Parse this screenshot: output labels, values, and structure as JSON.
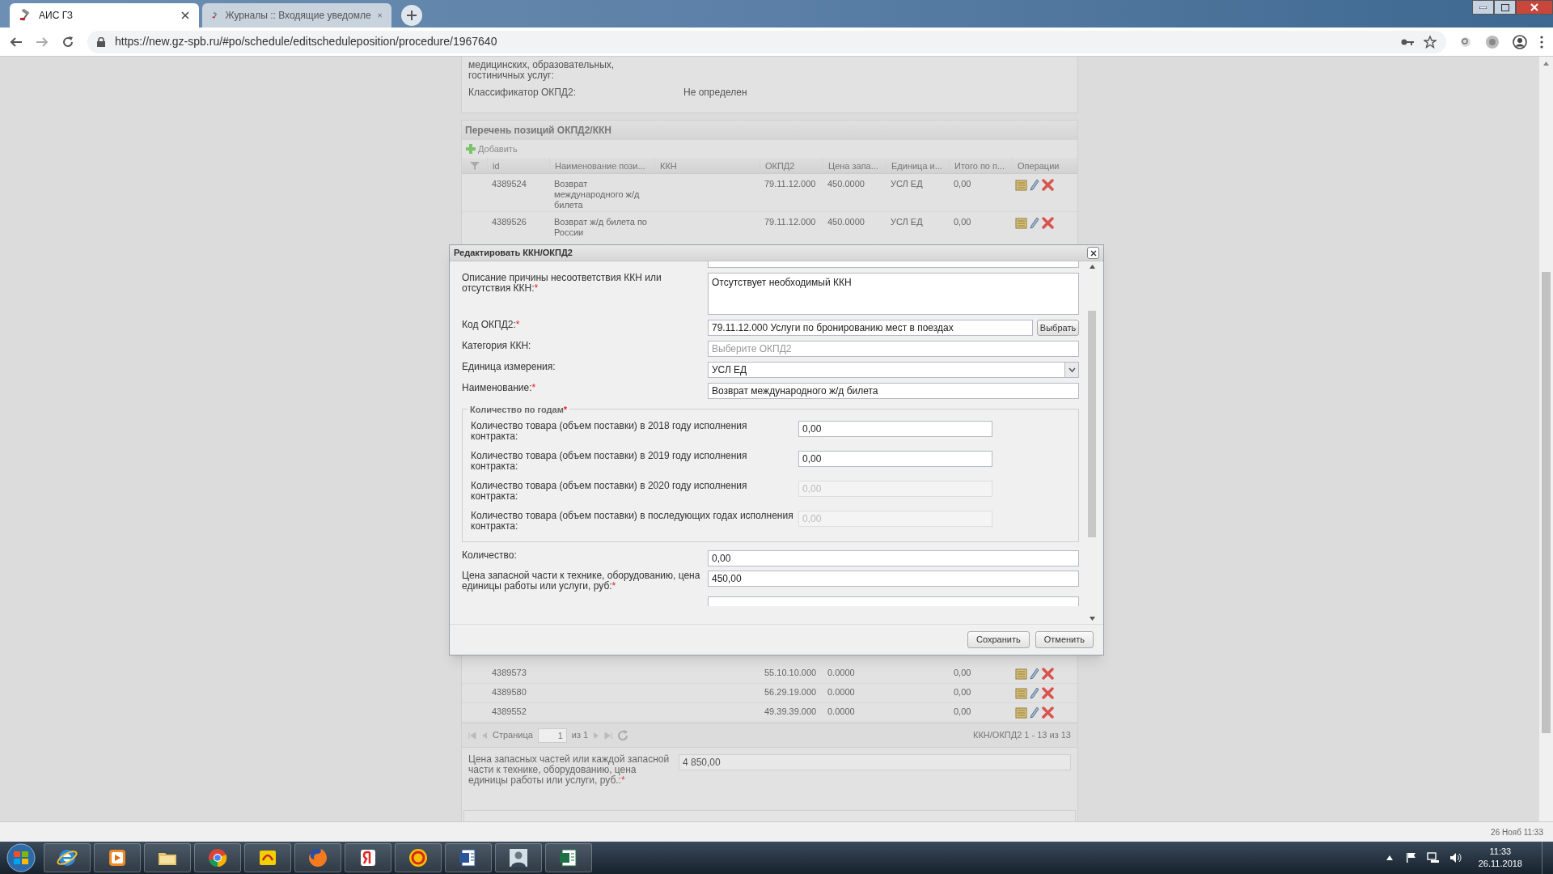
{
  "browser": {
    "tabs": [
      {
        "title": "АИС ГЗ",
        "selected": true
      },
      {
        "title": "Журналы :: Входящие уведомле",
        "selected": false
      }
    ],
    "url": "https://new.gz-spb.ru/#po/schedule/editscheduleposition/procedure/1967640"
  },
  "page": {
    "info_rows": [
      {
        "label": "медицинских, образовательных, гостиничных услуг:"
      },
      {
        "label": "Классификатор ОКПД2:",
        "value": "Не определен"
      }
    ],
    "grid": {
      "title": "Перечень позиций ОКПД2/ККН",
      "add_button": "Добавить",
      "columns": [
        "id",
        "Наименование пози...",
        "ККН",
        "ОКПД2",
        "Цена запа...",
        "Единица и...",
        "Итого по п...",
        "Операции"
      ],
      "rows_above": [
        {
          "id": "4389524",
          "name": "Возврат международного ж/д билета",
          "okpd2": "79.11.12.000",
          "price": "450.0000",
          "unit": "УСЛ ЕД",
          "total": "0,00"
        },
        {
          "id": "4389526",
          "name": "Возврат ж/д билета по России",
          "okpd2": "79.11.12.000",
          "price": "450.0000",
          "unit": "УСЛ ЕД",
          "total": "0,00"
        }
      ],
      "rows_below": [
        {
          "id": "4389573",
          "okpd2": "55.10.10.000",
          "price": "0.0000",
          "total": "0,00"
        },
        {
          "id": "4389580",
          "okpd2": "56.29.19.000",
          "price": "0.0000",
          "total": "0,00"
        },
        {
          "id": "4389552",
          "okpd2": "49.39.39.000",
          "price": "0.0000",
          "total": "0,00"
        }
      ],
      "pager": {
        "page_label": "Страница",
        "page": "1",
        "of": "из 1",
        "summary": "ККН/ОКПД2 1 - 13 из 13"
      }
    },
    "price_field": {
      "label": "Цена запасных частей или каждой запасной части к технике, оборудованию, цена единицы работы или услуги, руб.:",
      "required_mark": "*",
      "value": "4 850,00"
    }
  },
  "dialog": {
    "title": "Редактировать ККН/ОКПД2",
    "fields": [
      {
        "kind": "textarea",
        "label": "Описание причины несоответствия ККН или отсутствия ККН:",
        "required_mark": "*",
        "value": "Отсутствует необходимый ККН"
      },
      {
        "kind": "picker",
        "label": "Код ОКПД2:",
        "required_mark": "*",
        "value": "79.11.12.000 Услуги по бронированию мест в поездах",
        "button": "Выбрать"
      },
      {
        "kind": "text",
        "label": "Категория ККН:",
        "placeholder": "Выберите ОКПД2"
      },
      {
        "kind": "select",
        "label": "Единица измерения:",
        "value": "УСЛ ЕД"
      },
      {
        "kind": "text",
        "label": "Наименование:",
        "required_mark": "*",
        "value": "Возврат  международного ж/д билета"
      }
    ],
    "years": {
      "legend": "Количество по годам",
      "required_mark": "*",
      "rows": [
        {
          "label": "Количество товара (объем поставки) в 2018 году исполнения контракта:",
          "value": "0,00",
          "disabled": false
        },
        {
          "label": "Количество товара (объем поставки) в 2019 году исполнения контракта:",
          "value": "0,00",
          "disabled": false
        },
        {
          "label": "Количество товара (объем поставки) в 2020 году исполнения контракта:",
          "value": "0,00",
          "disabled": true
        },
        {
          "label": "Количество товара (объем поставки) в последующих годах исполнения контракта:",
          "value": "0,00",
          "disabled": true
        }
      ]
    },
    "fields_after": [
      {
        "kind": "text",
        "label": "Количество:",
        "value": "0,00"
      },
      {
        "kind": "text",
        "label": "Цена запасной части к технике, оборудованию, цена единицы работы или услуги, руб:",
        "required_mark": "*",
        "value": "450,00"
      }
    ],
    "buttons": [
      "Сохранить",
      "Отменить"
    ]
  },
  "status_bar": {
    "right": "26 Нояб 11:33"
  },
  "taskbar": {
    "apps": [
      {
        "kind": "ie"
      },
      {
        "kind": "media"
      },
      {
        "kind": "folder"
      },
      {
        "kind": "chrome"
      },
      {
        "kind": "pdf"
      },
      {
        "kind": "firefox"
      },
      {
        "kind": "yandex"
      },
      {
        "kind": "onec"
      },
      {
        "kind": "word"
      },
      {
        "kind": "person"
      },
      {
        "kind": "excel"
      }
    ],
    "clock": {
      "time": "11:33",
      "date": "26.11.2018"
    }
  }
}
